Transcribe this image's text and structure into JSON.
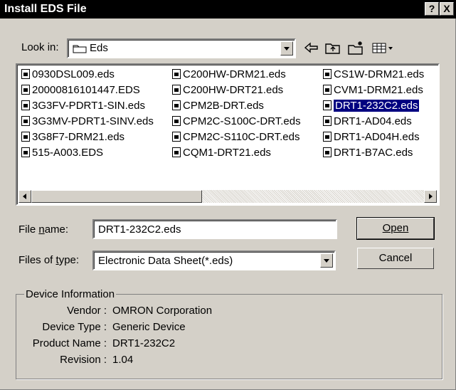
{
  "window": {
    "title": "Install EDS File",
    "help_label": "?",
    "close_label": "X"
  },
  "lookin": {
    "label": "Look in:",
    "value": "Eds"
  },
  "files": [
    {
      "name": "0930DSL009.eds",
      "selected": false
    },
    {
      "name": "20000816101447.EDS",
      "selected": false
    },
    {
      "name": "3G3FV-PDRT1-SIN.eds",
      "selected": false
    },
    {
      "name": "3G3MV-PDRT1-SINV.eds",
      "selected": false
    },
    {
      "name": "3G8F7-DRM21.eds",
      "selected": false
    },
    {
      "name": "515-A003.EDS",
      "selected": false
    },
    {
      "name": "C200HW-DRM21.eds",
      "selected": false
    },
    {
      "name": "C200HW-DRT21.eds",
      "selected": false
    },
    {
      "name": "CPM2B-DRT.eds",
      "selected": false
    },
    {
      "name": "CPM2C-S100C-DRT.eds",
      "selected": false
    },
    {
      "name": "CPM2C-S110C-DRT.eds",
      "selected": false
    },
    {
      "name": "CQM1-DRT21.eds",
      "selected": false
    },
    {
      "name": "CS1W-DRM21.eds",
      "selected": false
    },
    {
      "name": "CVM1-DRM21.eds",
      "selected": false
    },
    {
      "name": "DRT1-232C2.eds",
      "selected": true
    },
    {
      "name": "DRT1-AD04.eds",
      "selected": false
    },
    {
      "name": "DRT1-AD04H.eds",
      "selected": false
    },
    {
      "name": "DRT1-B7AC.eds",
      "selected": false
    }
  ],
  "filename": {
    "label": "File name:",
    "value": "DRT1-232C2.eds"
  },
  "filetype": {
    "label": "Files of type:",
    "value": "Electronic Data Sheet(*.eds)"
  },
  "buttons": {
    "open": "Open",
    "cancel": "Cancel"
  },
  "device_info": {
    "legend": "Device Information",
    "rows": [
      {
        "key": "Vendor :",
        "value": "OMRON Corporation"
      },
      {
        "key": "Device Type :",
        "value": "Generic Device"
      },
      {
        "key": "Product Name :",
        "value": "DRT1-232C2"
      },
      {
        "key": "Revision :",
        "value": "1.04"
      }
    ]
  }
}
